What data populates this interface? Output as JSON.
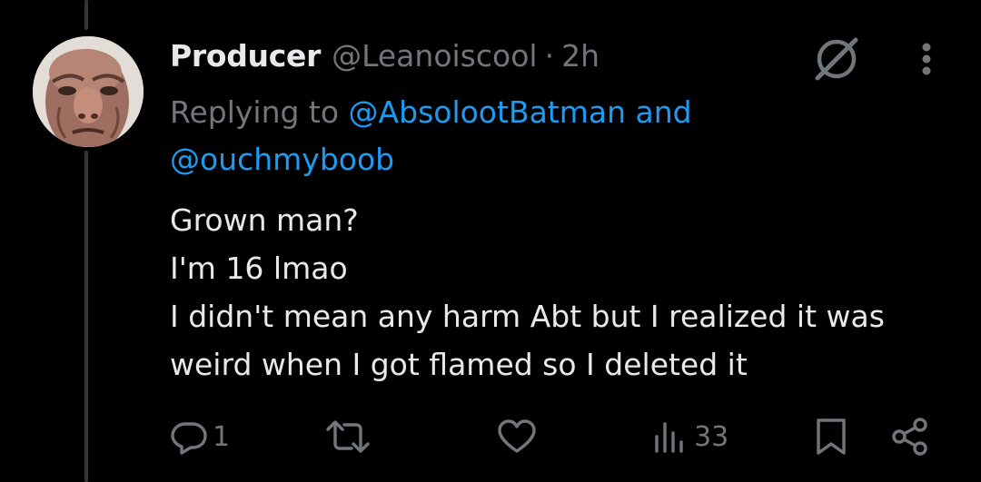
{
  "tweet": {
    "author": {
      "display_name": "Producer",
      "handle": "@Leanoiscool",
      "separator": "·",
      "time": "2h"
    },
    "replying": {
      "prefix": "Replying to",
      "mention1": "@AbsolootBatman",
      "and": "and",
      "mention2": "@ouchmyboob"
    },
    "text_lines": [
      "Grown man?",
      "I'm 16 lmao",
      "I didn't mean any harm Abt but I realized it was",
      "weird when I got flamed so I deleted it"
    ]
  },
  "actions": {
    "replies": "1",
    "reposts": "",
    "likes": "",
    "views": "33"
  },
  "icons": {
    "grok": "grok-icon",
    "more": "more-vertical-icon",
    "reply": "reply-icon",
    "repost": "repost-icon",
    "like": "heart-icon",
    "views": "views-bar-icon",
    "bookmark": "bookmark-icon",
    "share": "share-icon"
  },
  "colors": {
    "background": "#000000",
    "text": "#e7e9ea",
    "muted": "#71767b",
    "accent": "#1d9bf0",
    "thread_line": "#333639"
  }
}
